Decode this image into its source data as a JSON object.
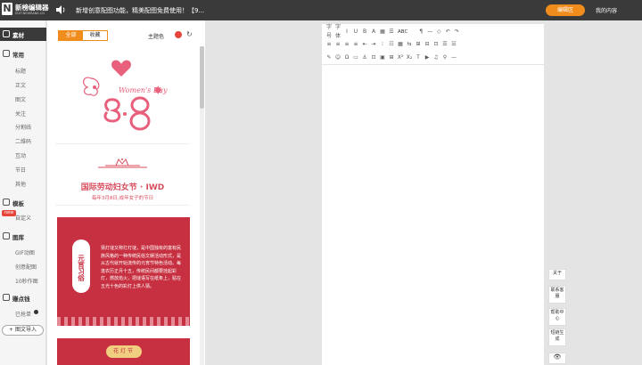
{
  "topbar": {
    "logo_title": "新榜编辑器",
    "logo_sub": "EDIT.NEWRANK.CN",
    "notice": "新增创意配图功能，精美配图免费使用！【9...",
    "edit_button": "编辑区",
    "my_content": "我的内容"
  },
  "nav": {
    "sections": [
      {
        "label": "素材",
        "active": true,
        "icon": "material-icon"
      },
      {
        "label": "常用",
        "active": false,
        "icon": "layers-icon"
      },
      {
        "label": "模板",
        "active": false,
        "icon": "template-icon"
      },
      {
        "label": "图库",
        "active": false,
        "icon": "image-icon"
      },
      {
        "label": "赚点钱",
        "active": false,
        "icon": "money-icon"
      }
    ],
    "common_items": [
      "标题",
      "正文",
      "图文",
      "关注",
      "分割线",
      "二维码",
      "互动",
      "节日",
      "其他"
    ],
    "template_items": [
      "自定义"
    ],
    "gallery_items": [
      "GIF动图",
      "创意配图",
      "10秒作图"
    ],
    "earn_items": [
      "已抢单"
    ],
    "new_tag": "new",
    "import_button": "+ 图文导入"
  },
  "templates": {
    "tabs": [
      {
        "label": "全部",
        "active": true
      },
      {
        "label": "收藏",
        "active": false
      }
    ],
    "theme_label": "主题色",
    "theme_color": "#e8453c",
    "card1": {
      "script": "Women's Day",
      "date": "3·8"
    },
    "card2": {
      "title": "国际劳动妇女节 · IWD",
      "subtitle": "每年3月8日,成年女子的节日"
    },
    "card3": {
      "vertical_title": "元宵习俗",
      "body": "猜灯谜又称打灯谜，是中国独有的富有民族风格的一种传统民俗文娱活动形式，是从古代就开始流传的元宵节特色活动。每逢农历正月十五，传统民间都要挂起彩灯，燃放焰火，把谜语写在纸条上，贴在五光十色的彩灯上供人猜。"
    },
    "card4": {
      "title": "花灯节"
    }
  },
  "editor": {
    "toolbar_row1": [
      "字号",
      "字体",
      "I",
      "U",
      "B",
      "A",
      "▦",
      "☰",
      "ABC",
      "¶",
      "—",
      "◇",
      "↶",
      "↷"
    ],
    "toolbar_row2": [
      "≡",
      "≡",
      "≡",
      "≡",
      "⇤",
      "⇥",
      "⁝",
      "☷",
      "▦",
      "⇆",
      "⊞",
      "⊟",
      "⊡",
      "☰",
      "☱"
    ],
    "toolbar_row3": [
      "✎",
      "☺",
      "Ω",
      "▭",
      "⚓",
      "⊡",
      "▣",
      "⊞",
      "X²",
      "X₂",
      "T",
      "▶",
      "♫",
      "⚲",
      "—"
    ]
  },
  "right_panel": [
    "关于",
    "联系客服",
    "帮助中心",
    "短链生成"
  ],
  "colors": {
    "accent": "#f08c1c",
    "topbar": "#3a3a3a",
    "red": "#c73040",
    "pink": "#e8607c"
  }
}
